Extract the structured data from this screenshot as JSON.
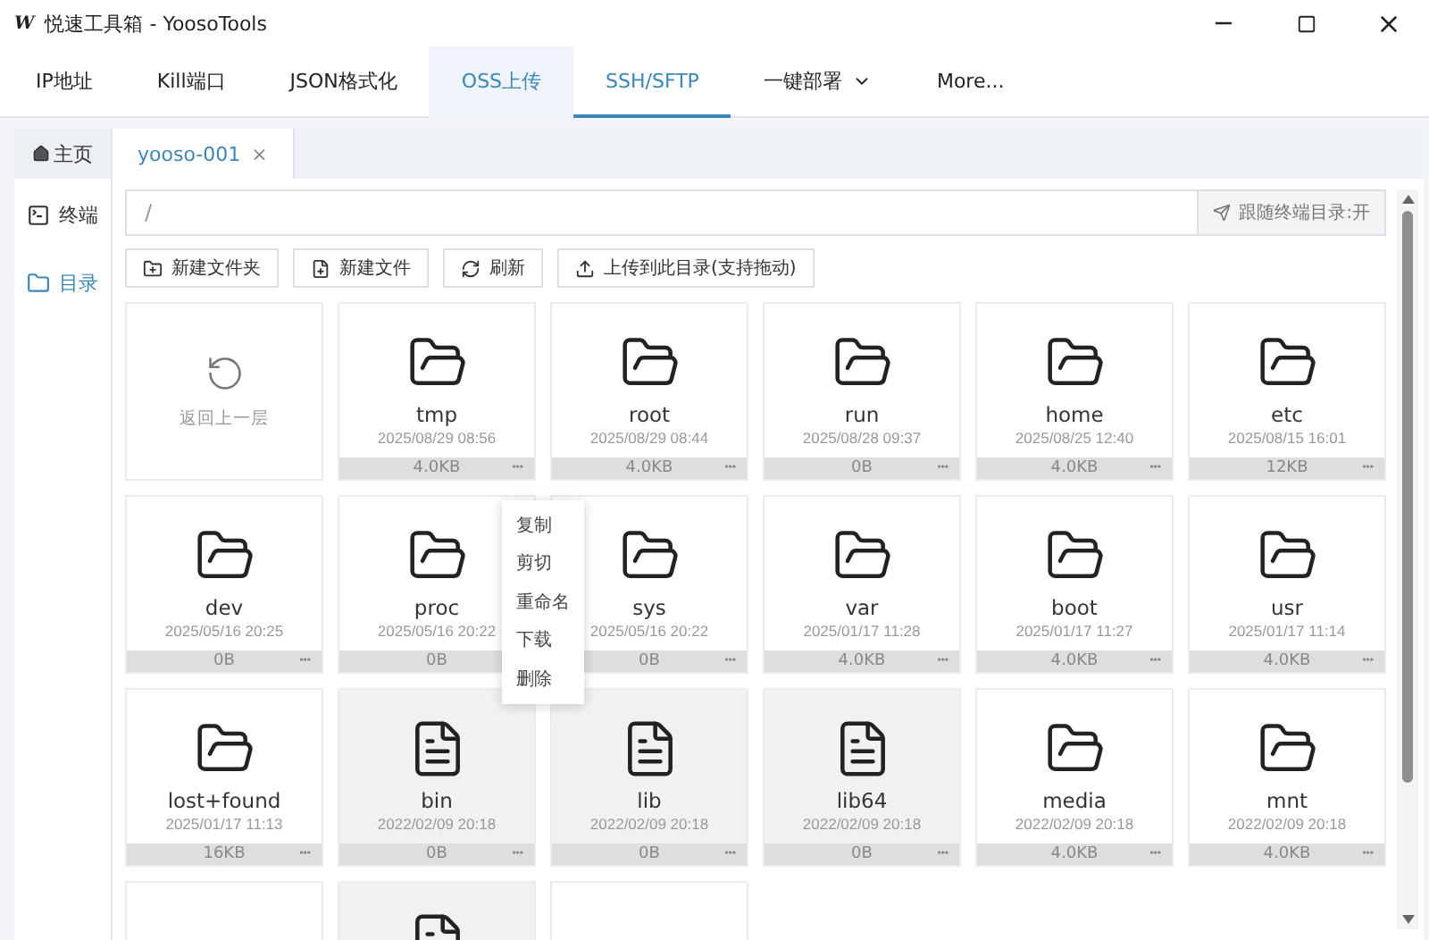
{
  "window": {
    "logo": "W",
    "title": "悦速工具箱 - YoosoTools"
  },
  "tabs": [
    {
      "label": "IP地址",
      "selected": false,
      "hovered": false
    },
    {
      "label": "Kill端口",
      "selected": false,
      "hovered": false
    },
    {
      "label": "JSON格式化",
      "selected": false,
      "hovered": false
    },
    {
      "label": "OSS上传",
      "selected": false,
      "hovered": true
    },
    {
      "label": "SSH/SFTP",
      "selected": true,
      "hovered": false
    },
    {
      "label": "一键部署",
      "selected": false,
      "hovered": false,
      "dropdown": true
    },
    {
      "label": "More...",
      "selected": false,
      "hovered": false
    }
  ],
  "sidebar": {
    "header": "主页",
    "items": [
      {
        "label": "终端",
        "kind": "terminal",
        "selected": false
      },
      {
        "label": "目录",
        "kind": "folder",
        "selected": true
      }
    ]
  },
  "session_tabs": [
    {
      "label": "yooso-001",
      "close": "×",
      "selected": true
    }
  ],
  "path": {
    "value": "/",
    "follow_button": "跟随终端目录:开"
  },
  "toolbar": [
    {
      "label": "新建文件夹",
      "kind": "new-folder"
    },
    {
      "label": "新建文件",
      "kind": "new-file"
    },
    {
      "label": "刷新",
      "kind": "refresh"
    },
    {
      "label": "上传到此目录(支持拖动)",
      "kind": "upload"
    }
  ],
  "back_card": {
    "label": "返回上一层"
  },
  "files": [
    {
      "name": "tmp",
      "date": "2025/08/29 08:56",
      "size": "4.0KB",
      "more": "•••",
      "kind": "folder"
    },
    {
      "name": "root",
      "date": "2025/08/29 08:44",
      "size": "4.0KB",
      "more": "•••",
      "kind": "folder"
    },
    {
      "name": "run",
      "date": "2025/08/28 09:37",
      "size": "0B",
      "more": "•••",
      "kind": "folder"
    },
    {
      "name": "home",
      "date": "2025/08/25 12:40",
      "size": "4.0KB",
      "more": "•••",
      "kind": "folder"
    },
    {
      "name": "etc",
      "date": "2025/08/15 16:01",
      "size": "12KB",
      "more": "•••",
      "kind": "folder"
    },
    {
      "name": "dev",
      "date": "2025/05/16 20:25",
      "size": "0B",
      "more": "•••",
      "kind": "folder"
    },
    {
      "name": "proc",
      "date": "2025/05/16 20:22",
      "size": "0B",
      "kind": "folder"
    },
    {
      "name": "sys",
      "date": "2025/05/16 20:22",
      "size": "0B",
      "more": "•••",
      "kind": "folder"
    },
    {
      "name": "var",
      "date": "2025/01/17 11:28",
      "size": "4.0KB",
      "more": "•••",
      "kind": "folder"
    },
    {
      "name": "boot",
      "date": "2025/01/17 11:27",
      "size": "4.0KB",
      "more": "•••",
      "kind": "folder"
    },
    {
      "name": "usr",
      "date": "2025/01/17 11:14",
      "size": "4.0KB",
      "more": "•••",
      "kind": "folder"
    },
    {
      "name": "lost+found",
      "date": "2025/01/17 11:13",
      "size": "16KB",
      "more": "•••",
      "kind": "folder"
    },
    {
      "name": "bin",
      "date": "2022/02/09 20:18",
      "size": "0B",
      "more": "•••",
      "kind": "link"
    },
    {
      "name": "lib",
      "date": "2022/02/09 20:18",
      "size": "0B",
      "more": "•••",
      "kind": "link"
    },
    {
      "name": "lib64",
      "date": "2022/02/09 20:18",
      "size": "0B",
      "more": "•••",
      "kind": "link"
    },
    {
      "name": "media",
      "date": "2022/02/09 20:18",
      "size": "4.0KB",
      "more": "•••",
      "kind": "folder"
    },
    {
      "name": "mnt",
      "date": "2022/02/09 20:18",
      "size": "4.0KB",
      "more": "•••",
      "kind": "folder"
    }
  ],
  "partial_cards": [
    {
      "kind": "folder"
    },
    {
      "kind": "link"
    },
    {
      "kind": "folder"
    }
  ],
  "context_menu": {
    "items": [
      "复制",
      "剪切",
      "重命名",
      "下载",
      "删除"
    ]
  }
}
